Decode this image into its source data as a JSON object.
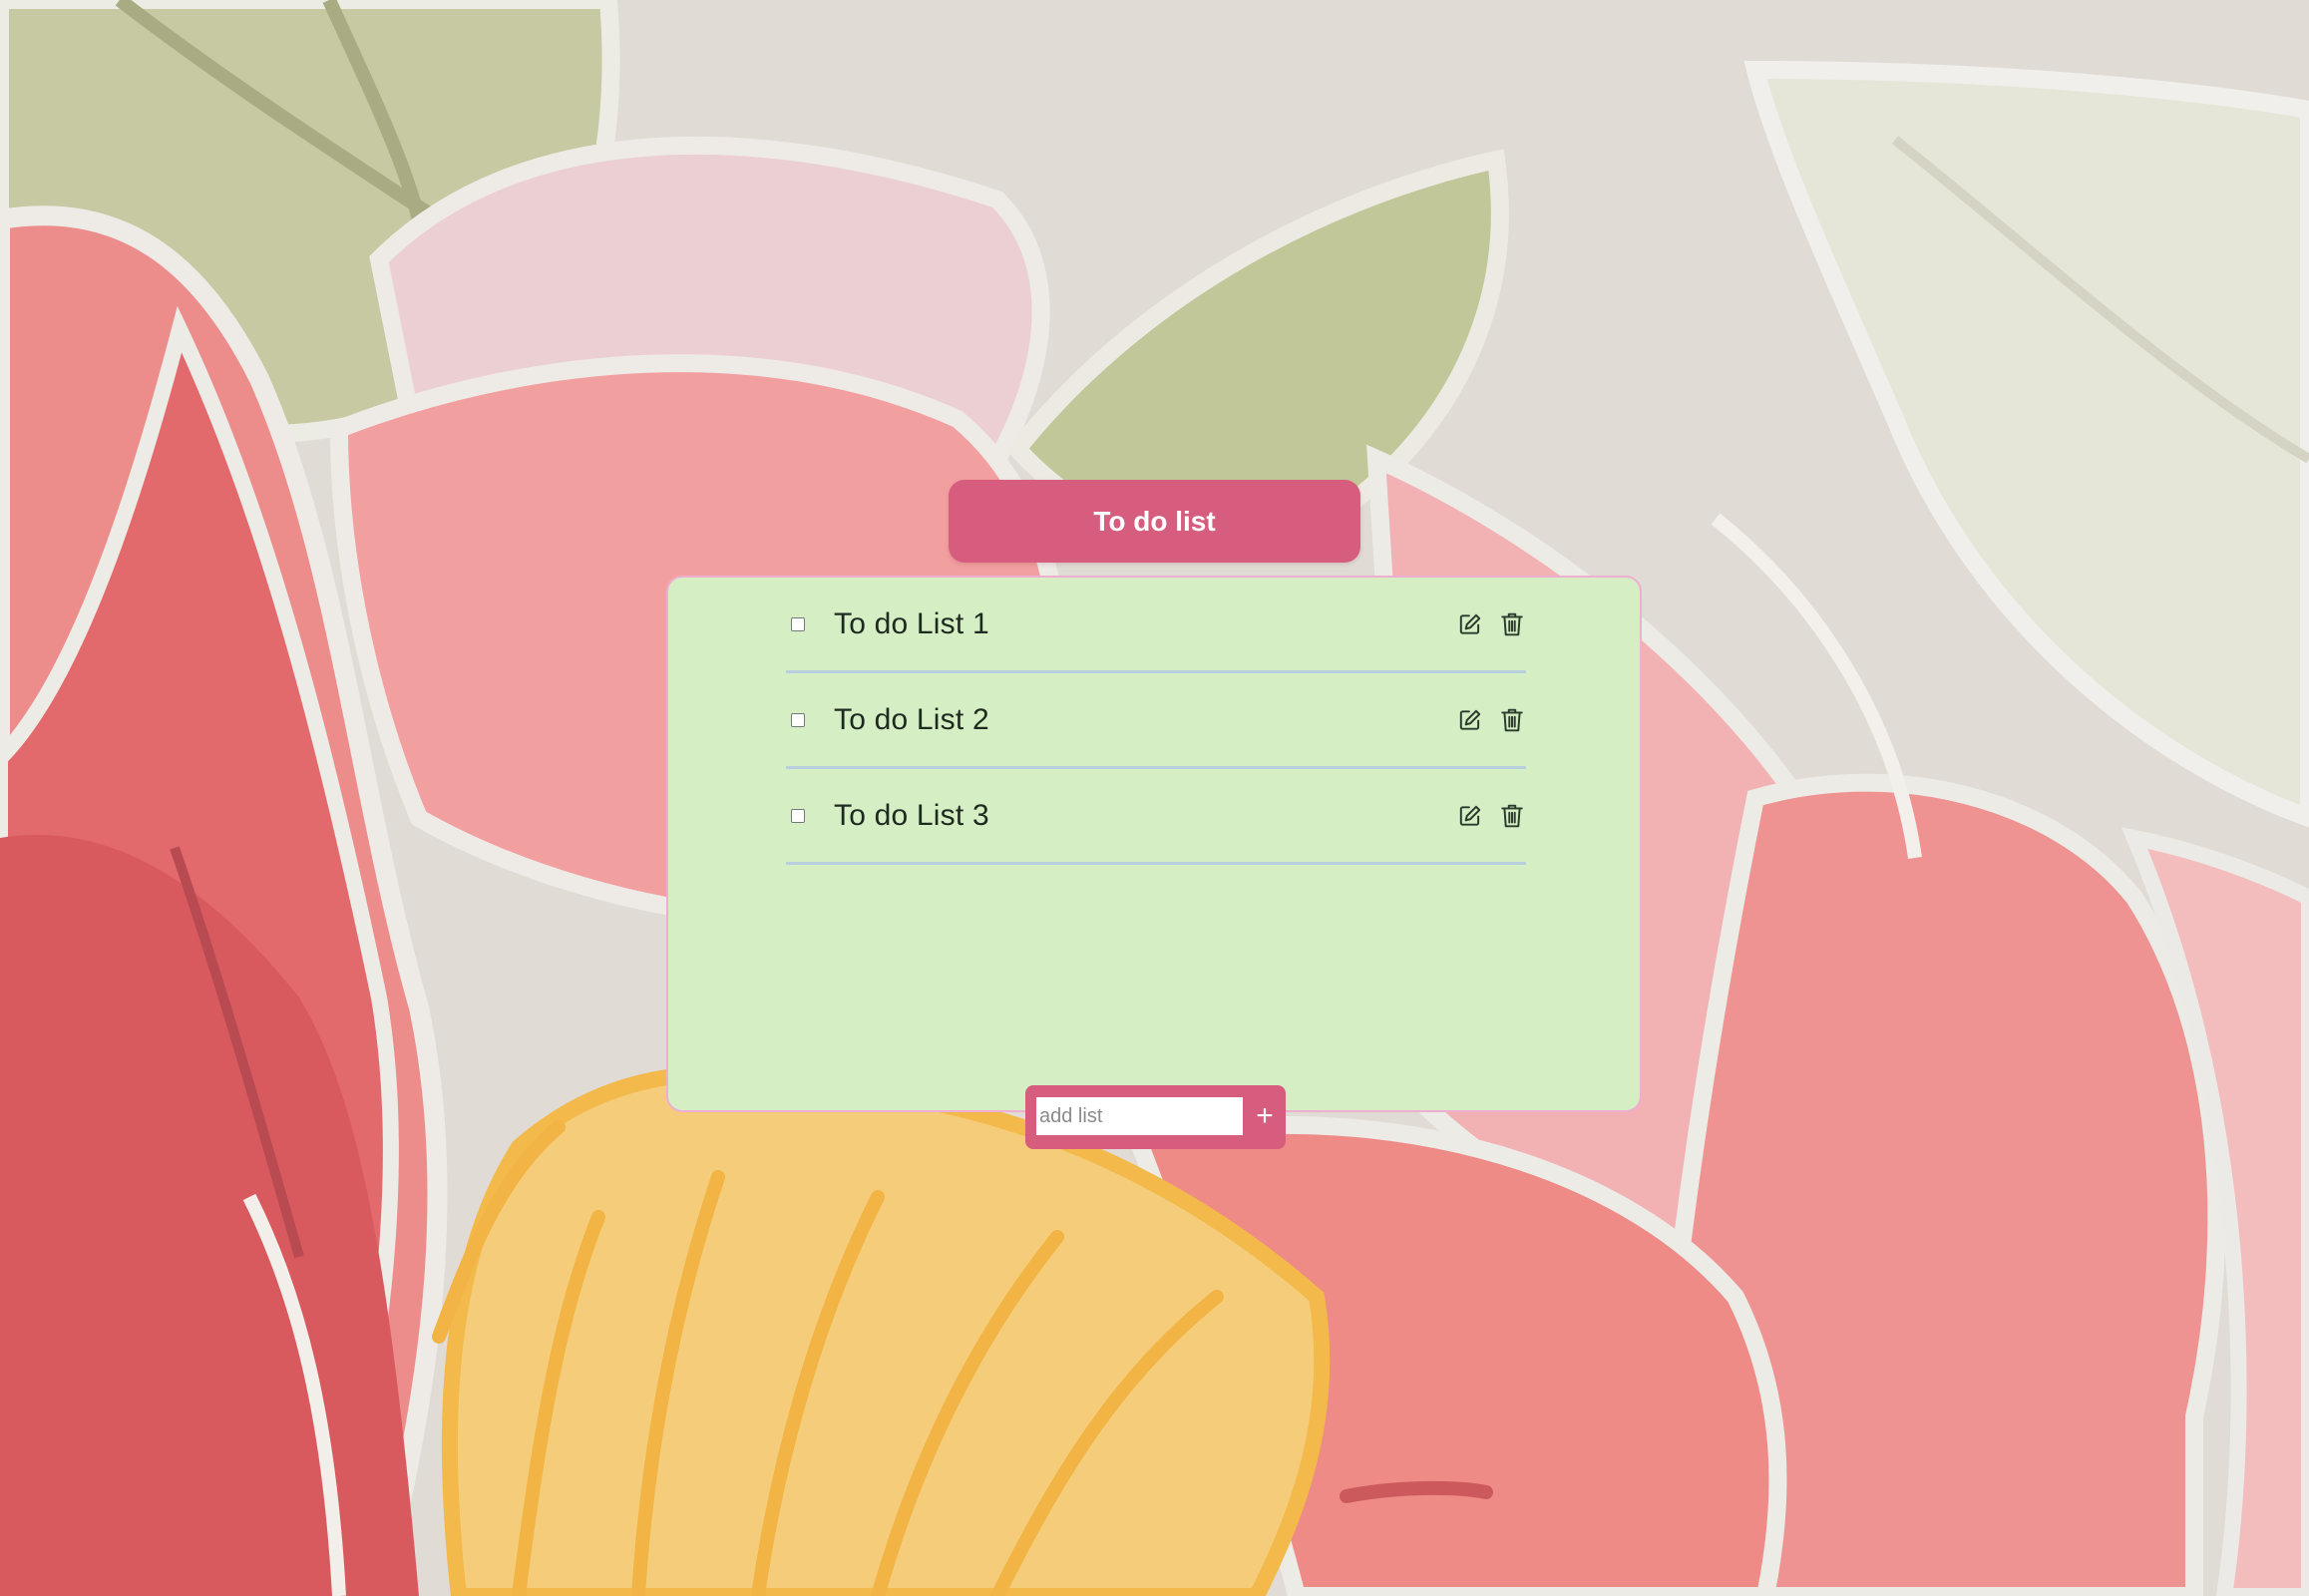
{
  "header": {
    "title": "To do list"
  },
  "todos": [
    {
      "label": "To do List 1",
      "checked": false
    },
    {
      "label": "To do List 2",
      "checked": false
    },
    {
      "label": "To do List 3",
      "checked": false
    }
  ],
  "add_form": {
    "placeholder": "add list",
    "add_label": "+"
  },
  "icons": {
    "edit": "edit-icon",
    "delete": "trash-icon",
    "add": "plus-icon"
  },
  "colors": {
    "accent": "#d75d7f",
    "panel_background": "#d5eec4",
    "panel_border": "#eeaed0",
    "divider": "#b7d0e0",
    "item_text": "#1d2a1e"
  }
}
